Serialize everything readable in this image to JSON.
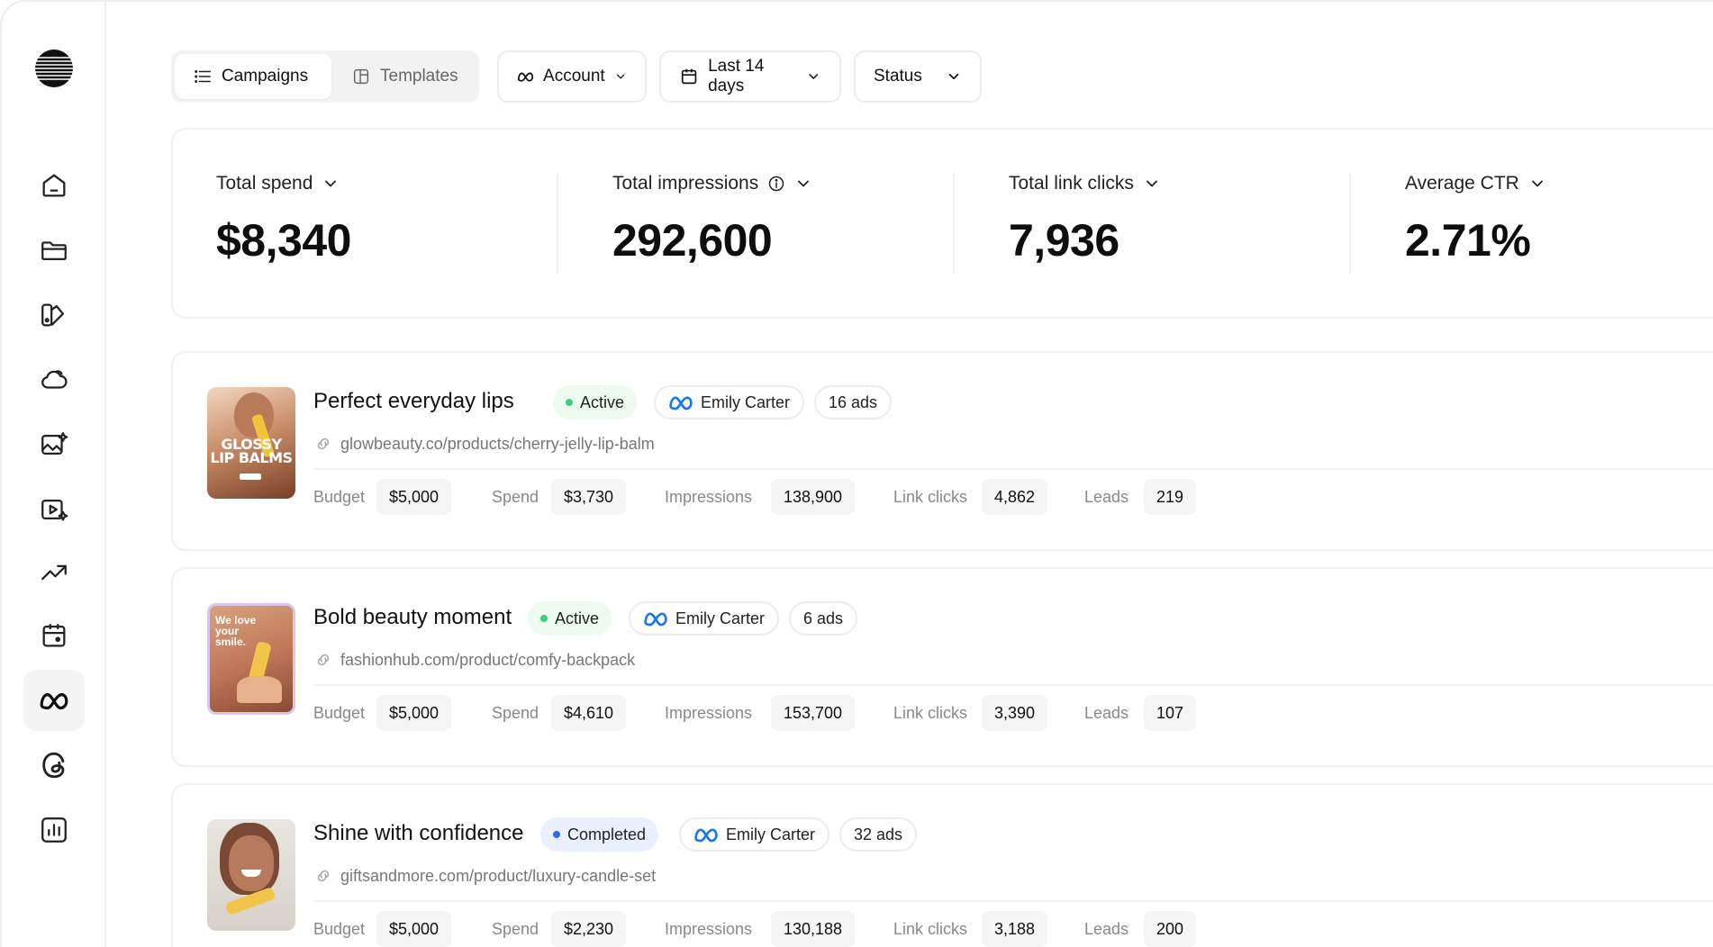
{
  "toolbar": {
    "tabs": [
      {
        "label": "Campaigns",
        "icon": "list-icon",
        "active": true
      },
      {
        "label": "Templates",
        "icon": "template-icon",
        "active": false
      }
    ],
    "account_label": "Account",
    "date_label": "Last 14 days",
    "status_label": "Status"
  },
  "metrics": [
    {
      "label": "Total spend",
      "value": "$8,340"
    },
    {
      "label": "Total impressions",
      "value": "292,600",
      "info": true
    },
    {
      "label": "Total link clicks",
      "value": "7,936"
    },
    {
      "label": "Average CTR",
      "value": "2.71%"
    }
  ],
  "stat_labels": {
    "budget": "Budget",
    "spend": "Spend",
    "impressions": "Impressions",
    "link_clicks": "Link clicks",
    "leads": "Leads"
  },
  "campaigns": [
    {
      "title": "Perfect everyday lips",
      "status": "Active",
      "owner": "Emily Carter",
      "ads": "16 ads",
      "url": "glowbeauty.co/products/cherry-jelly-lip-balm",
      "thumb_text": "GLOSSY LIP BALMS",
      "budget": "$5,000",
      "spend": "$3,730",
      "impressions": "138,900",
      "link_clicks": "4,862",
      "leads": "219"
    },
    {
      "title": "Bold beauty moment",
      "status": "Active",
      "owner": "Emily Carter",
      "ads": "6 ads",
      "url": "fashionhub.com/product/comfy-backpack",
      "thumb_text": "We love your smile.",
      "budget": "$5,000",
      "spend": "$4,610",
      "impressions": "153,700",
      "link_clicks": "3,390",
      "leads": "107"
    },
    {
      "title": "Shine with confidence",
      "status": "Completed",
      "owner": "Emily Carter",
      "ads": "32 ads",
      "url": "giftsandmore.com/product/luxury-candle-set",
      "budget": "$5,000",
      "spend": "$2,230",
      "impressions": "130,188",
      "link_clicks": "3,188",
      "leads": "200"
    }
  ],
  "colors": {
    "active_dot": "#3fcf7a",
    "completed_dot": "#2f6be6",
    "meta_blue": "#1877f2"
  }
}
